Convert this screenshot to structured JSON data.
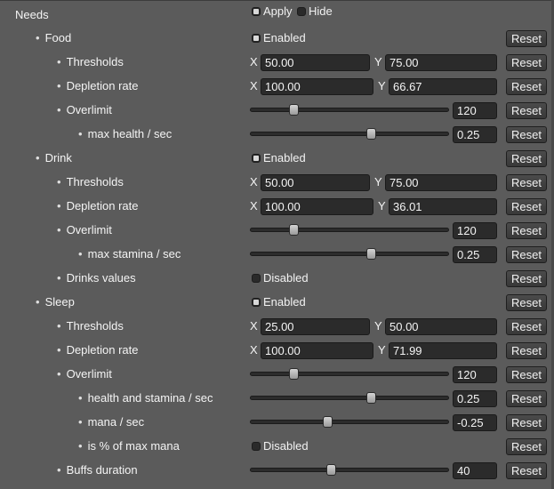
{
  "header": {
    "label": "Needs",
    "apply": {
      "label": "Apply",
      "checked": true
    },
    "hide": {
      "label": "Hide",
      "checked": false
    }
  },
  "reset_label": "Reset",
  "rows": [
    {
      "name": "food",
      "label": "Food",
      "indent": 1,
      "type": "check",
      "check_label": "Enabled",
      "checked": true
    },
    {
      "name": "food-thresholds",
      "label": "Thresholds",
      "indent": 2,
      "type": "xy",
      "x_label": "X",
      "x": "50.00",
      "y_label": "Y",
      "y": "75.00"
    },
    {
      "name": "food-depletion-rate",
      "label": "Depletion rate",
      "indent": 2,
      "type": "xy",
      "x_label": "X",
      "x": "100.00",
      "y_label": "Y",
      "y": "66.67"
    },
    {
      "name": "food-overlimit",
      "label": "Overlimit",
      "indent": 2,
      "type": "slider",
      "value": "120",
      "pos": 0.2
    },
    {
      "name": "food-max-health",
      "label": "max health / sec",
      "indent": 3,
      "type": "slider",
      "value": "0.25",
      "pos": 0.61
    },
    {
      "name": "drink",
      "label": "Drink",
      "indent": 1,
      "type": "check",
      "check_label": "Enabled",
      "checked": true
    },
    {
      "name": "drink-thresholds",
      "label": "Thresholds",
      "indent": 2,
      "type": "xy",
      "x_label": "X",
      "x": "50.00",
      "y_label": "Y",
      "y": "75.00"
    },
    {
      "name": "drink-depletion-rate",
      "label": "Depletion rate",
      "indent": 2,
      "type": "xy",
      "x_label": "X",
      "x": "100.00",
      "y_label": "Y",
      "y": "36.01"
    },
    {
      "name": "drink-overlimit",
      "label": "Overlimit",
      "indent": 2,
      "type": "slider",
      "value": "120",
      "pos": 0.2
    },
    {
      "name": "drink-max-stamina",
      "label": "max stamina / sec",
      "indent": 3,
      "type": "slider",
      "value": "0.25",
      "pos": 0.61
    },
    {
      "name": "drinks-values",
      "label": "Drinks values",
      "indent": 2,
      "type": "check",
      "check_label": "Disabled",
      "checked": false
    },
    {
      "name": "sleep",
      "label": "Sleep",
      "indent": 1,
      "type": "check",
      "check_label": "Enabled",
      "checked": true
    },
    {
      "name": "sleep-thresholds",
      "label": "Thresholds",
      "indent": 2,
      "type": "xy",
      "x_label": "X",
      "x": "25.00",
      "y_label": "Y",
      "y": "50.00"
    },
    {
      "name": "sleep-depletion-rate",
      "label": "Depletion rate",
      "indent": 2,
      "type": "xy",
      "x_label": "X",
      "x": "100.00",
      "y_label": "Y",
      "y": "71.99"
    },
    {
      "name": "sleep-overlimit",
      "label": "Overlimit",
      "indent": 2,
      "type": "slider",
      "value": "120",
      "pos": 0.2
    },
    {
      "name": "sleep-health-stamina",
      "label": "health and stamina / sec",
      "indent": 3,
      "type": "slider",
      "value": "0.25",
      "pos": 0.61
    },
    {
      "name": "sleep-mana",
      "label": "mana / sec",
      "indent": 3,
      "type": "slider",
      "value": "-0.25",
      "pos": 0.38
    },
    {
      "name": "sleep-is-percent-max-mana",
      "label": "is % of max mana",
      "indent": 3,
      "type": "check",
      "check_label": "Disabled",
      "checked": false
    },
    {
      "name": "buffs-duration",
      "label": "Buffs duration",
      "indent": 2,
      "type": "slider",
      "value": "40",
      "pos": 0.4
    }
  ]
}
